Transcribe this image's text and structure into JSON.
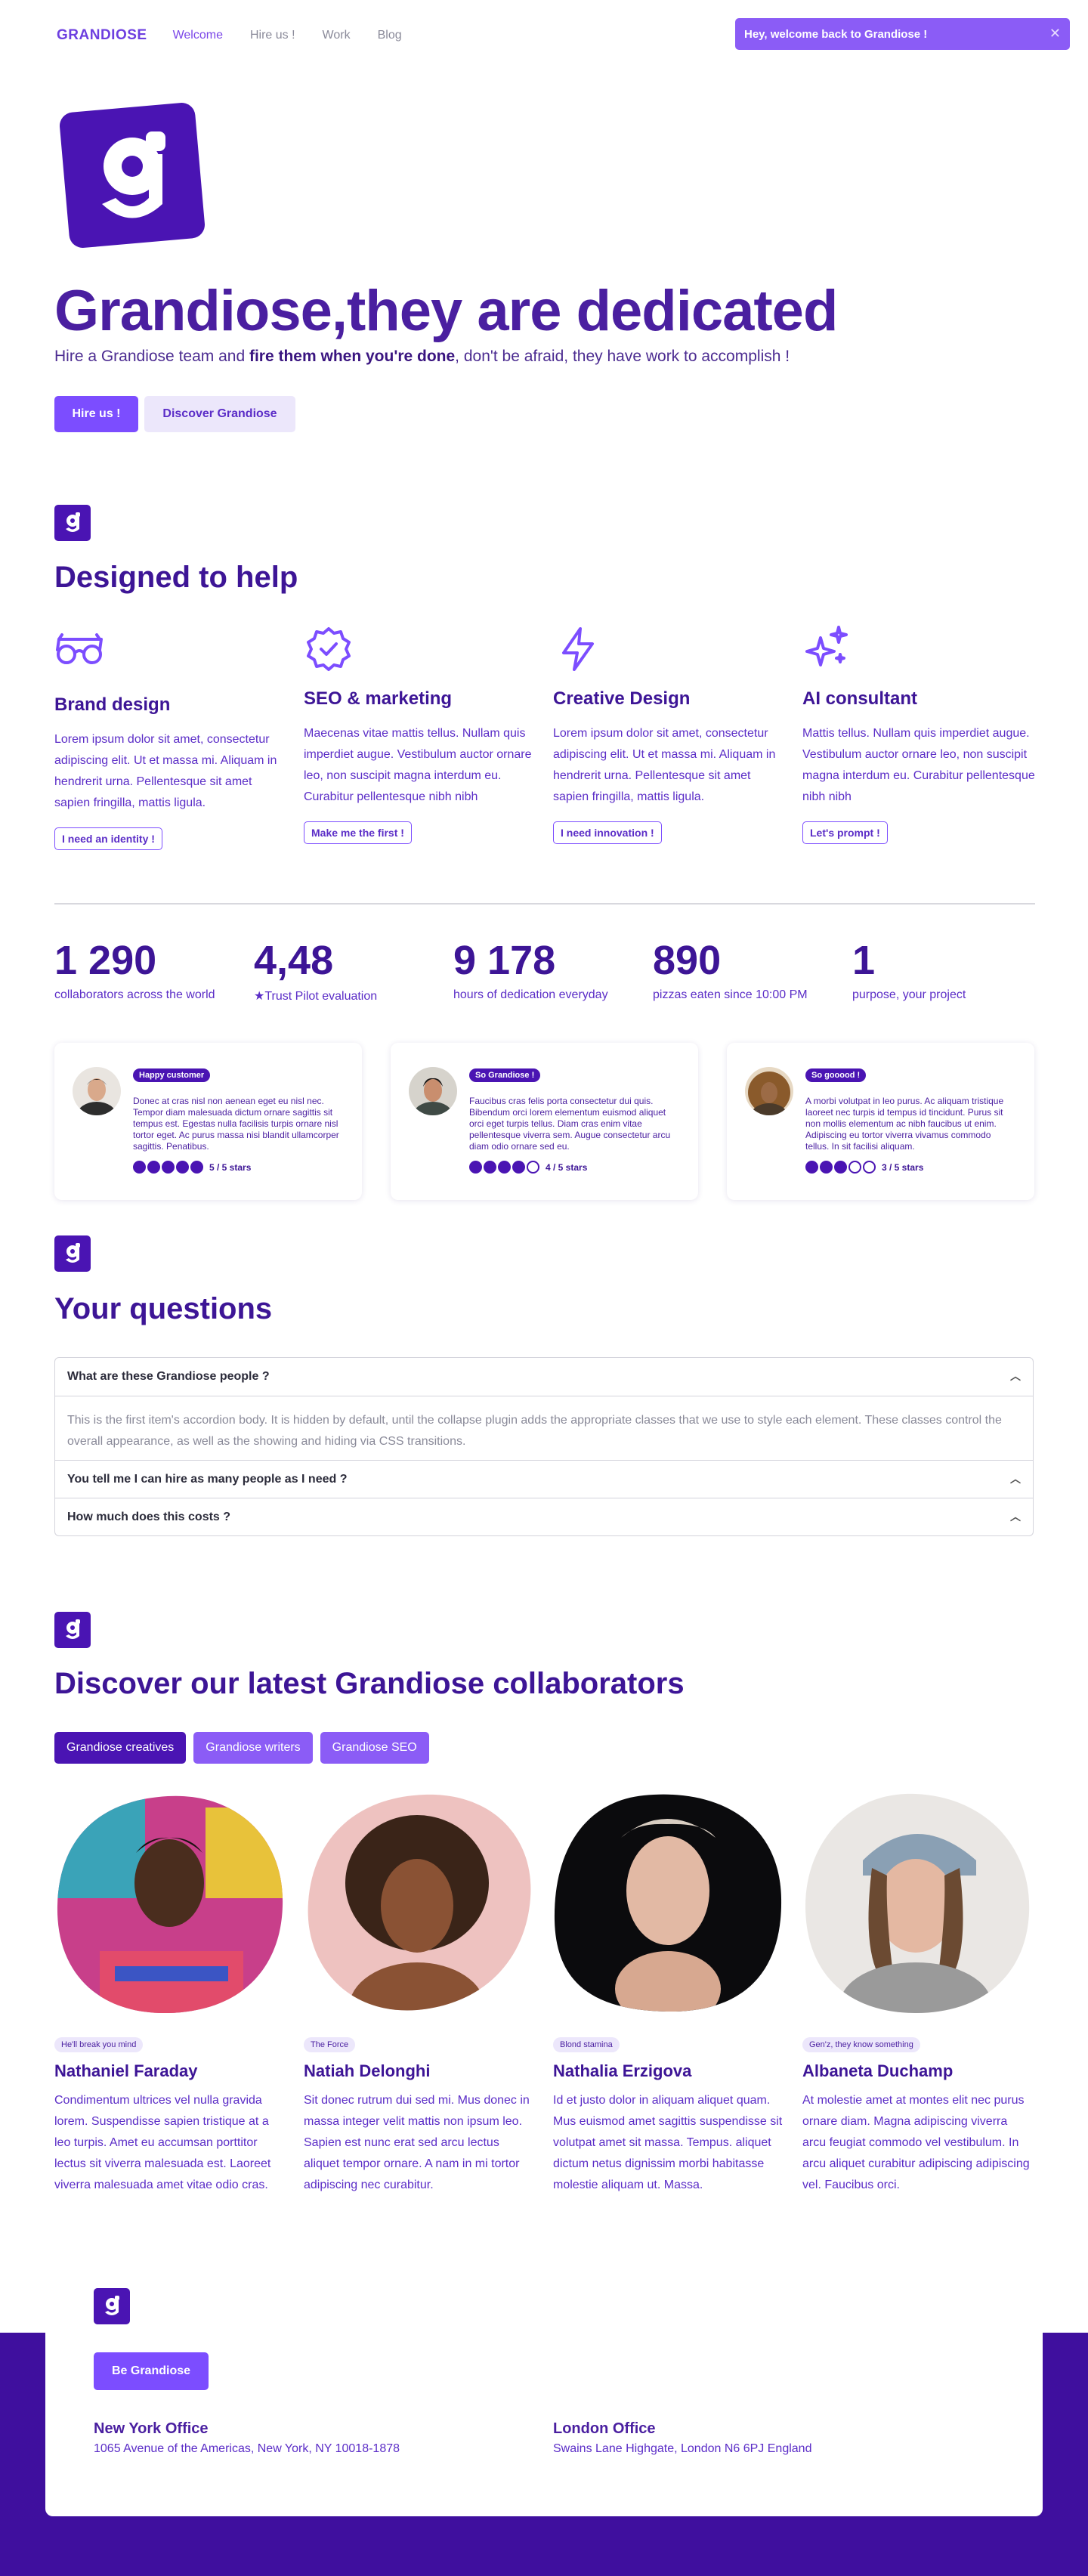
{
  "nav": {
    "brand": "GRANDIOSE",
    "links": [
      "Welcome",
      "Hire us !",
      "Work",
      "Blog"
    ],
    "toast": "Hey, welcome back to Grandiose !"
  },
  "hero": {
    "title": "Grandiose,they are dedicated",
    "sub_before": "Hire a Grandiose team and ",
    "sub_bold": "fire them when you're done",
    "sub_after": ", don't be afraid, they have work to accomplish !",
    "btn_primary": "Hire us !",
    "btn_secondary": "Discover Grandiose"
  },
  "features": {
    "title": "Designed to help",
    "items": [
      {
        "icon": "glasses-icon",
        "title": "Brand design",
        "text": "Lorem ipsum dolor sit amet, consectetur adipiscing elit. Ut et massa mi. Aliquam in hendrerit urna. Pellentesque sit amet sapien fringilla, mattis ligula.",
        "button": "I need an identity !"
      },
      {
        "icon": "badge-check-icon",
        "title": "SEO & marketing",
        "text": "Maecenas vitae mattis tellus. Nullam quis imperdiet augue. Vestibulum auctor ornare leo, non suscipit magna interdum eu. Curabitur pellentesque nibh nibh",
        "button": "Make me the first !"
      },
      {
        "icon": "lightning-icon",
        "title": "Creative Design",
        "text": "Lorem ipsum dolor sit amet, consectetur adipiscing elit. Ut et massa mi. Aliquam in hendrerit urna. Pellentesque sit amet sapien fringilla, mattis ligula.",
        "button": "I need innovation !"
      },
      {
        "icon": "sparkles-icon",
        "title": "AI consultant",
        "text": "Mattis tellus. Nullam quis imperdiet augue. Vestibulum auctor ornare leo, non suscipit magna interdum eu. Curabitur pellentesque nibh nibh",
        "button": "Let's prompt !"
      }
    ]
  },
  "stats": [
    {
      "num": "1 290",
      "label": "collaborators across the world"
    },
    {
      "num": "4,48",
      "label": "★Trust Pilot evaluation"
    },
    {
      "num": "9 178",
      "label": "hours of dedication everyday"
    },
    {
      "num": "890",
      "label": "pizzas eaten since 10:00 PM"
    },
    {
      "num": "1",
      "label": "purpose, your project"
    }
  ],
  "testimonials": [
    {
      "badge": "Happy customer",
      "text": "Donec at cras nisl non aenean eget eu nisl nec. Tempor diam malesuada dictum ornare sagittis sit tempus est. Egestas nulla facilisis turpis ornare nisl tortor eget. Ac purus massa nisi blandit ullamcorper sagittis. Penatibus.",
      "rating": 5,
      "rating_text": "5 / 5 stars"
    },
    {
      "badge": "So Grandiose !",
      "text": "Faucibus cras felis porta consectetur dui quis. Bibendum orci lorem elementum euismod aliquet orci eget turpis tellus. Diam cras enim vitae pellentesque viverra sem. Augue consectetur arcu diam odio ornare sed eu.",
      "rating": 4,
      "rating_text": "4 / 5 stars"
    },
    {
      "badge": "So gooood !",
      "text": "A morbi volutpat in leo purus. Ac aliquam tristique laoreet nec turpis id tempus id tincidunt. Purus sit non mollis elementum ac nibh faucibus ut enim. Adipiscing eu tortor viverra vivamus commodo tellus. In sit facilisi aliquam.",
      "rating": 3,
      "rating_text": "3 / 5 stars"
    }
  ],
  "faq": {
    "title": "Your questions",
    "items": [
      {
        "q": "What are these Grandiose people ?",
        "a": "This is the first item's accordion body. It is hidden by default, until the collapse plugin adds the appropriate classes that we use to style each element. These classes control the overall appearance, as well as the showing and hiding via CSS transitions."
      },
      {
        "q": "You tell me I can hire as many people as I need ?"
      },
      {
        "q": "How much does this costs ?"
      }
    ]
  },
  "team": {
    "title": "Discover our latest Grandiose collaborators",
    "tabs": [
      "Grandiose creatives",
      "Grandiose writers",
      "Grandiose SEO"
    ],
    "people": [
      {
        "tag": "He'll break you mind",
        "name": "Nathaniel Faraday",
        "text": "Condimentum ultrices vel nulla gravida lorem. Suspendisse sapien tristique at a leo turpis. Amet eu accumsan porttitor lectus sit viverra malesuada est. Laoreet viverra malesuada amet vitae odio cras."
      },
      {
        "tag": "The Force",
        "name": "Natiah Delonghi",
        "text": "Sit donec rutrum dui sed mi. Mus donec in massa integer velit mattis non ipsum leo. Sapien est nunc erat sed arcu lectus aliquet tempor ornare. A nam in mi tortor adipiscing nec curabitur."
      },
      {
        "tag": "Blond stamina",
        "name": "Nathalia Erzigova",
        "text": "Id et justo dolor in aliquam aliquet quam. Mus euismod amet sagittis suspendisse sit volutpat amet sit massa. Tempus. aliquet dictum netus dignissim morbi habitasse molestie aliquam ut. Massa."
      },
      {
        "tag": "Gen'z, they know something",
        "name": "Albaneta Duchamp",
        "text": "At molestie amet at montes elit nec purus ornare diam. Magna adipiscing viverra arcu feugiat commodo vel vestibulum. In arcu aliquet curabitur adipiscing adipiscing vel. Faucibus orci."
      }
    ]
  },
  "footer": {
    "button": "Be Grandiose",
    "offices": [
      {
        "city": "New York Office",
        "address": "1065 Avenue of the Americas, New York, NY 10018-1878"
      },
      {
        "city": "London Office",
        "address": "Swains Lane Highgate, London N6 6PJ England"
      }
    ]
  },
  "colors": {
    "brand": "#4a14b3",
    "accent": "#7c4dff",
    "soft": "#ece7fb",
    "footer": "#3f0f9e"
  }
}
